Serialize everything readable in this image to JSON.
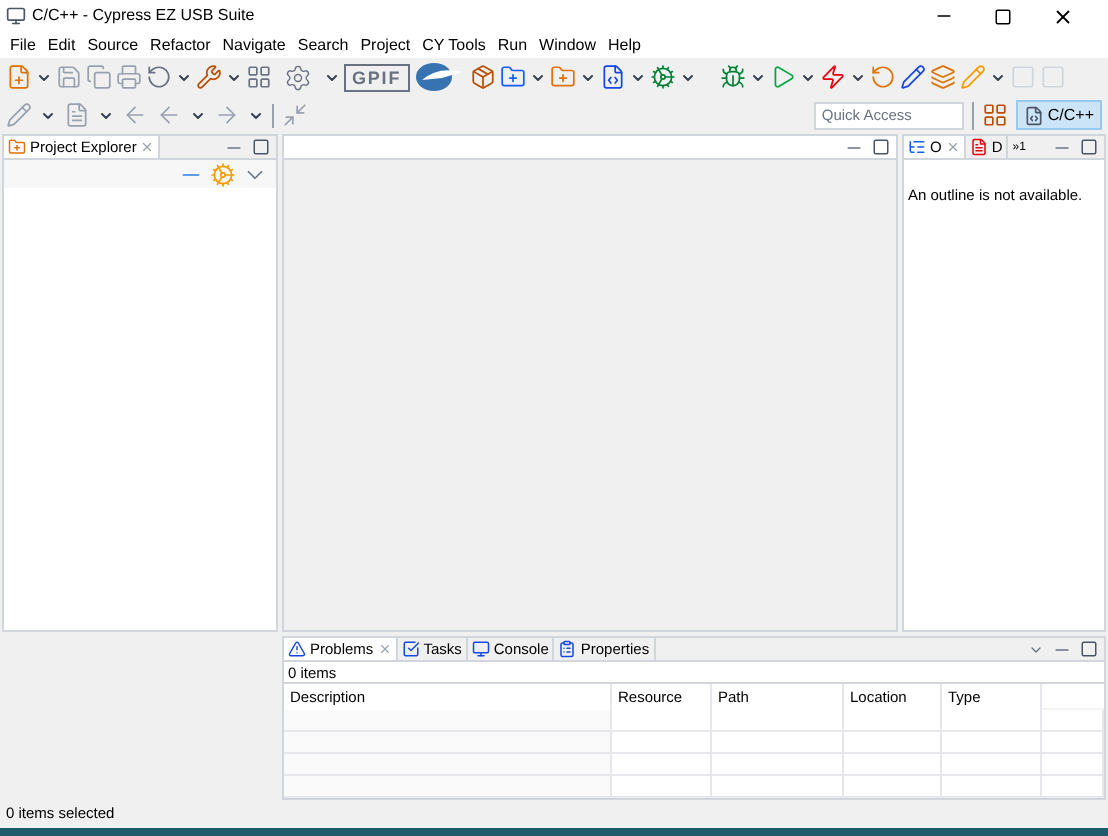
{
  "window": {
    "title": "C/C++ - Cypress EZ USB Suite"
  },
  "menu": [
    "File",
    "Edit",
    "Source",
    "Refactor",
    "Navigate",
    "Search",
    "Project",
    "CY Tools",
    "Run",
    "Window",
    "Help"
  ],
  "toolbar": {
    "gpif_label": "GPIF",
    "quick_access": {
      "placeholder": "Quick Access"
    },
    "perspective": {
      "label": "C/C++",
      "selected": true
    }
  },
  "project_explorer": {
    "tab": "Project Explorer"
  },
  "outline": {
    "tabs": [
      {
        "label": "O",
        "selected": true
      },
      {
        "label": "D",
        "selected": false
      }
    ],
    "overflow": "»1",
    "message": "An outline is not available."
  },
  "bottom_panel": {
    "tabs": [
      {
        "label": "Problems",
        "selected": true
      },
      {
        "label": "Tasks",
        "selected": false
      },
      {
        "label": "Console",
        "selected": false
      },
      {
        "label": "Properties",
        "selected": false
      }
    ],
    "summary": "0 items",
    "columns": [
      "Description",
      "Resource",
      "Path",
      "Location",
      "Type"
    ]
  },
  "status_bar": "0 items selected"
}
